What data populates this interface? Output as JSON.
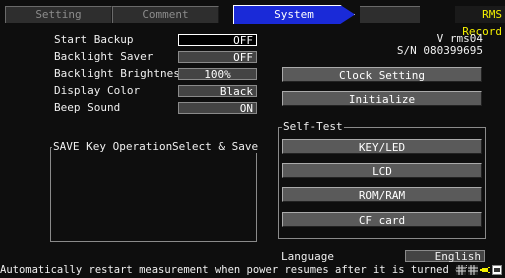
{
  "tabs": [
    {
      "label": "Setting"
    },
    {
      "label": "Comment"
    },
    {
      "label": "System"
    }
  ],
  "mode": "RMS Record",
  "device": {
    "version": "V rms04",
    "serial": "S/N 080399695"
  },
  "settings": {
    "start_backup": {
      "label": "Start Backup",
      "value": "OFF"
    },
    "backlight_saver": {
      "label": "Backlight Saver",
      "value": "OFF"
    },
    "backlight_brightness": {
      "label": "Backlight Brightness",
      "value": "100%"
    },
    "display_color": {
      "label": "Display Color",
      "value": "Black"
    },
    "beep_sound": {
      "label": "Beep Sound",
      "value": "ON"
    },
    "save_key": {
      "label": "SAVE Key Operation",
      "value": "Select & Save"
    }
  },
  "buttons": {
    "clock_setting": "Clock Setting",
    "initialize": "Initialize"
  },
  "self_test": {
    "title": "Self-Test",
    "buttons": [
      "KEY/LED",
      "LCD",
      "ROM/RAM",
      "CF card"
    ]
  },
  "language": {
    "label": "Language",
    "value": "English"
  },
  "status_text": "Automatically restart measurement when power resumes after it is turned off.",
  "colors": {
    "tab_active": "#1a2ad8",
    "mode_text": "#f4f000",
    "background": "#0e0e0e"
  }
}
